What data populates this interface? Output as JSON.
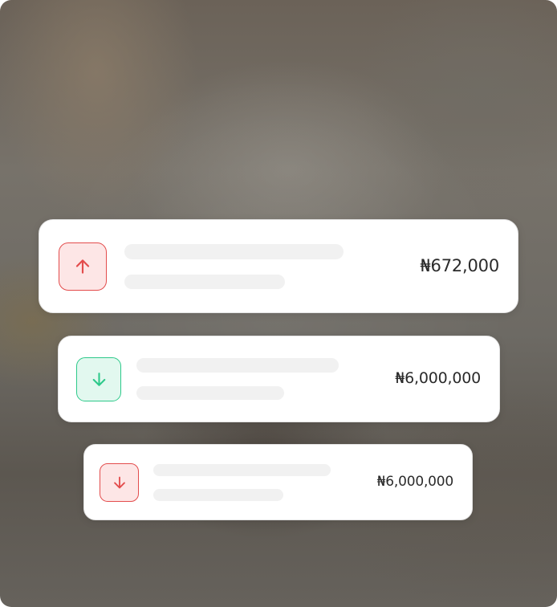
{
  "transactions": [
    {
      "direction": "up",
      "icon": "arrow-up-icon",
      "color": "#e34c4c",
      "tint": "#fde6e6",
      "amount": "₦672,000"
    },
    {
      "direction": "down",
      "icon": "arrow-down-icon",
      "color": "#2dc98a",
      "tint": "#e2f8ef",
      "amount": "₦6,000,000"
    },
    {
      "direction": "down",
      "icon": "arrow-down-icon",
      "color": "#e34c4c",
      "tint": "#fde6e6",
      "amount": "₦6,000,000"
    }
  ]
}
